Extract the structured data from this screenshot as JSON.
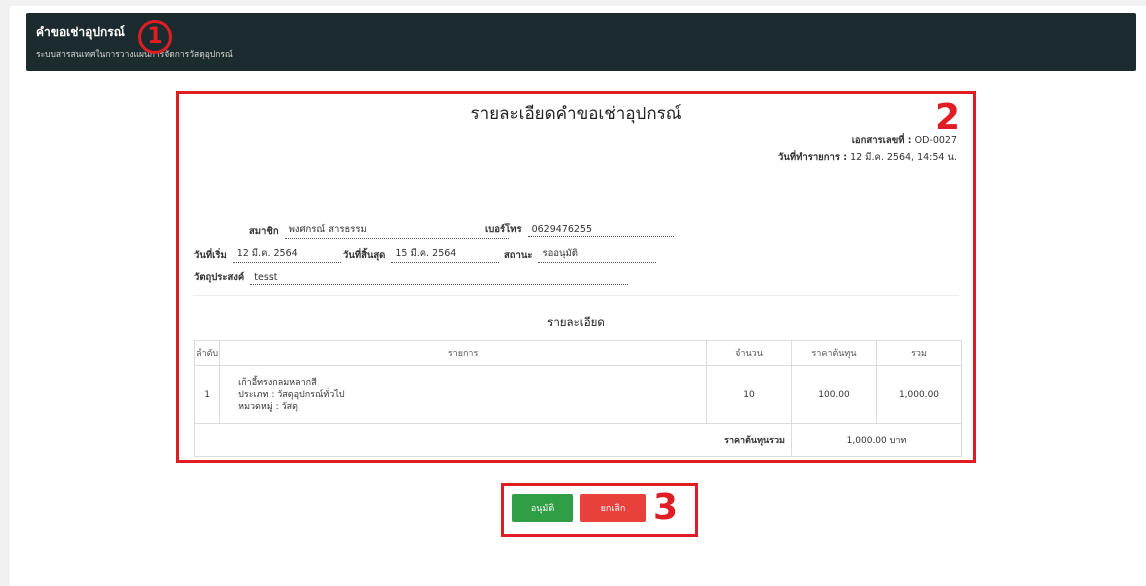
{
  "header": {
    "title": "คำขอเช่าอุปกรณ์",
    "subtitle": "ระบบสารสนเทศในการวางแผนการจัดการวัสดุอุปกรณ์"
  },
  "markers": {
    "one": "1",
    "two": "2",
    "three": "3"
  },
  "document": {
    "title": "รายละเอียดคำขอเช่าอุปกรณ์",
    "doc_no_label": "เอกสารเลขที่ :",
    "doc_no": "OD-0027",
    "date_label": "วันที่ทำรายการ :",
    "date": "12 มี.ค. 2564, 14:54 น."
  },
  "fields": {
    "member_label": "สมาชิก",
    "member": "พงศกรณ์ สารธรรม",
    "phone_label": "เบอร์โทร",
    "phone": "0629476255",
    "start_label": "วันที่เริ่ม",
    "start": "12 มี.ค. 2564",
    "end_label": "วันที่สิ้นสุด",
    "end": "15 มี.ค. 2564",
    "status_label": "สถานะ",
    "status": "รออนุมัติ",
    "purpose_label": "วัตถุประสงค์",
    "purpose": "tesst"
  },
  "details": {
    "title": "รายละเอียด",
    "headers": {
      "num": "ลำดับ",
      "item": "รายการ",
      "qty": "จำนวน",
      "price": "ราคาต้นทุน",
      "sum": "รวม"
    },
    "rows": [
      {
        "num": "1",
        "name": "เก้าอี้ทรงกลมหลากสี",
        "type": "ประเภท : วัสดุอุปกรณ์ทั่วไป",
        "category": "หมวดหมู่ : วัสดุ",
        "qty": "10",
        "price": "100.00",
        "sum": "1,000.00"
      }
    ],
    "total_label": "ราคาต้นทุนรวม",
    "total": "1,000.00 บาท"
  },
  "buttons": {
    "approve": "อนุมัติ",
    "cancel": "ยกเลิก"
  },
  "colors": {
    "header_bg": "#1c2b2d",
    "annotation_red": "#e01d24",
    "approve_green": "#2f9e44",
    "cancel_red": "#e8413b"
  }
}
